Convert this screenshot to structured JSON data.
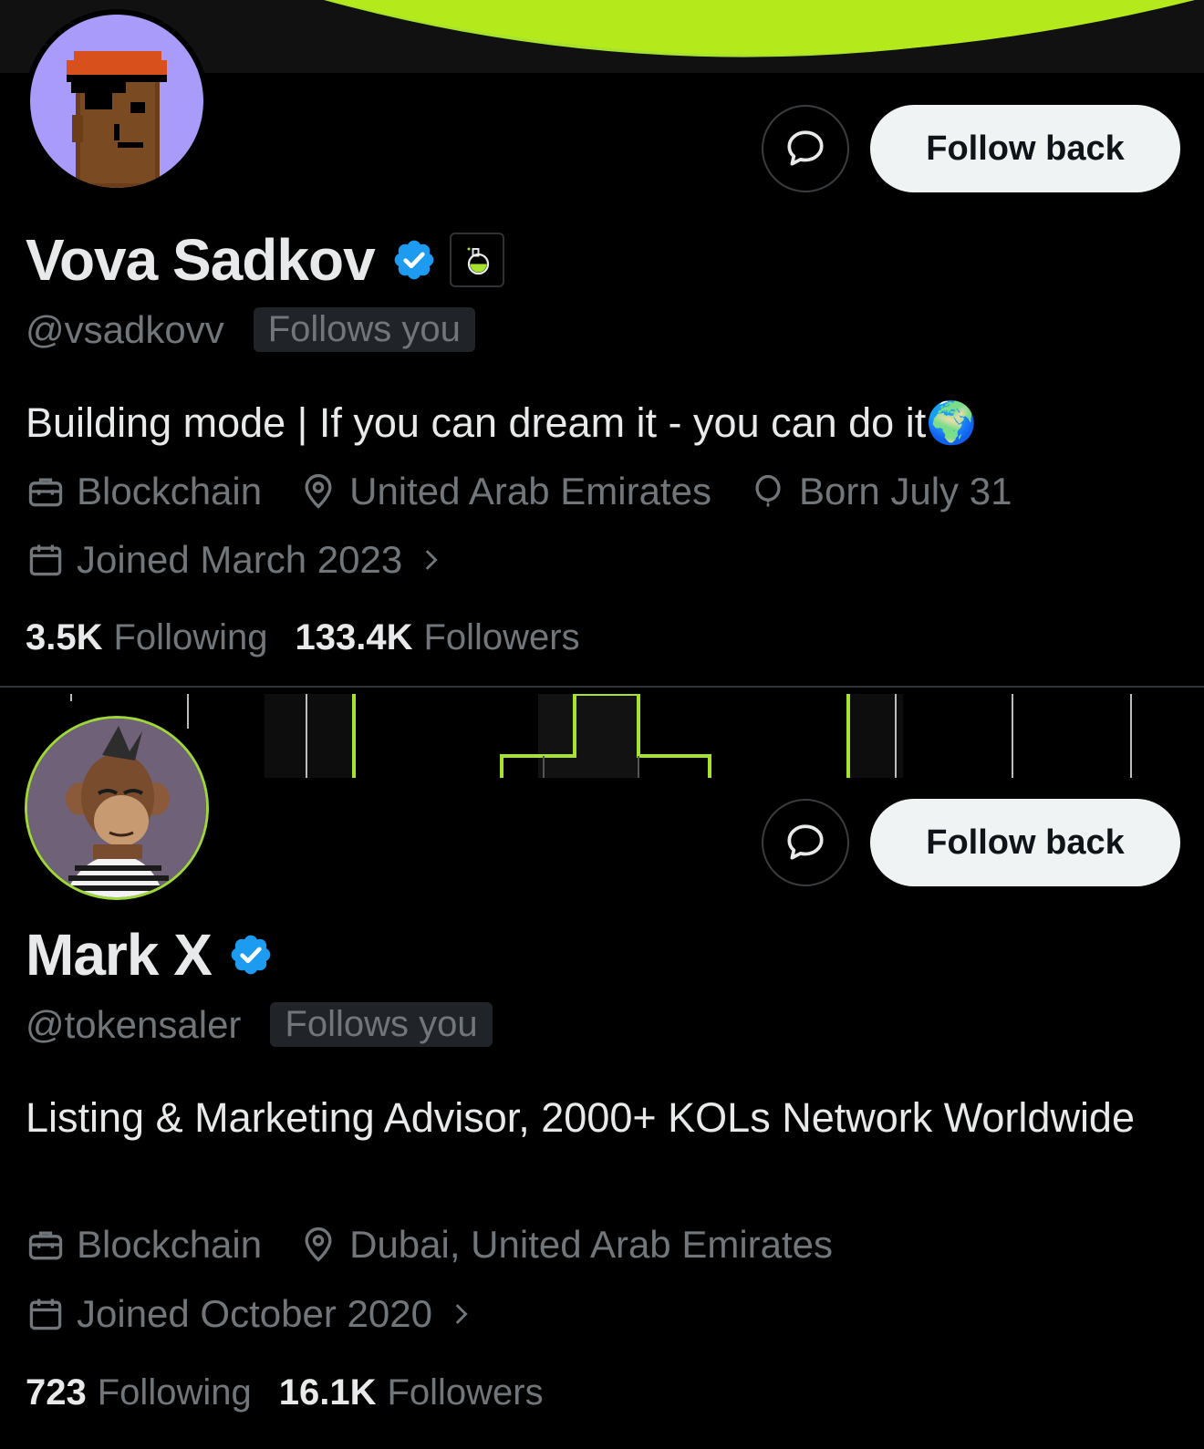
{
  "profiles": [
    {
      "name": "Vova Sadkov",
      "handle": "@vsadkovv",
      "follows_you": "Follows you",
      "bio": "Building mode | If you can dream it - you can do it🌍",
      "category": "Blockchain",
      "location": "United Arab Emirates",
      "birthday": "Born July 31",
      "joined": "Joined March 2023",
      "following_count": "3.5K",
      "following_label": "Following",
      "followers_count": "133.4K",
      "followers_label": "Followers",
      "follow_button": "Follow back",
      "verified": true
    },
    {
      "name": "Mark X",
      "handle": "@tokensaler",
      "follows_you": "Follows you",
      "bio": "Listing & Marketing Advisor, 2000+ KOLs Network Worldwide",
      "category": "Blockchain",
      "location": "Dubai, United Arab Emirates",
      "joined": "Joined October 2020",
      "following_count": "723",
      "following_label": "Following",
      "followers_count": "16.1K",
      "followers_label": "Followers",
      "follow_button": "Follow back",
      "verified": true
    }
  ],
  "colors": {
    "accent_green": "#a6e22e",
    "verified_blue": "#1d9bf0",
    "secondary_text": "#71767b",
    "primary_text": "#e7e9ea"
  },
  "icons": [
    "message-icon",
    "verified-badge-icon",
    "briefcase-icon",
    "location-pin-icon",
    "balloon-icon",
    "calendar-icon",
    "chevron-right-icon"
  ]
}
